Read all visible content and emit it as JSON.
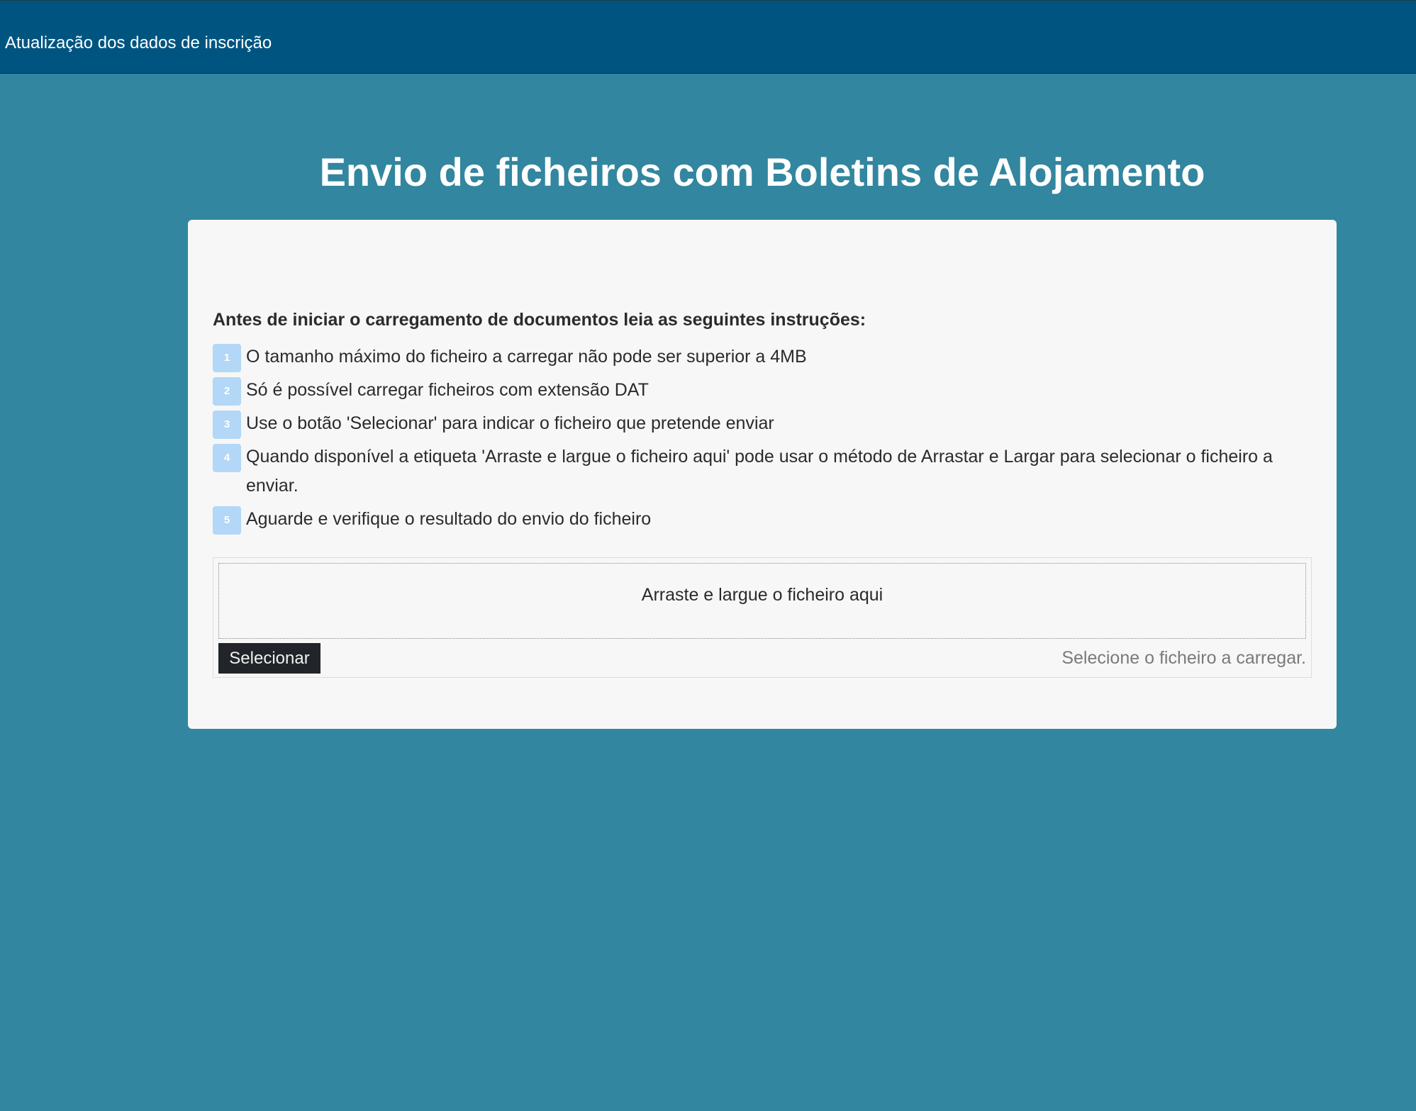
{
  "header": {
    "title": "Atualização dos dados de inscrição"
  },
  "page": {
    "title": "Envio de ficheiros com Boletins de Alojamento"
  },
  "instructions": {
    "heading": "Antes de iniciar o carregamento de documentos leia as seguintes instruções:",
    "steps": [
      {
        "number": "1",
        "text": "O tamanho máximo do ficheiro a carregar não pode ser superior a 4MB"
      },
      {
        "number": "2",
        "text": "Só é possível carregar ficheiros com extensão DAT"
      },
      {
        "number": "3",
        "text": "Use o botão 'Selecionar' para indicar o ficheiro que pretende enviar"
      },
      {
        "number": "4",
        "text": "Quando disponível a etiqueta 'Arraste e largue o ficheiro aqui' pode usar o método de Arrastar e Largar para selecionar o ficheiro a enviar."
      },
      {
        "number": "5",
        "text": "Aguarde e verifique o resultado do envio do ficheiro"
      }
    ]
  },
  "uploader": {
    "dropzone_label": "Arraste e largue o ficheiro aqui",
    "select_label": "Selecionar",
    "status_text": "Selecione o ficheiro a carregar."
  },
  "colors": {
    "background": "#32869f",
    "header_bg": "#005580",
    "panel_bg": "#f7f7f7",
    "step_badge": "#b3d7f7",
    "button_bg": "#212529"
  }
}
